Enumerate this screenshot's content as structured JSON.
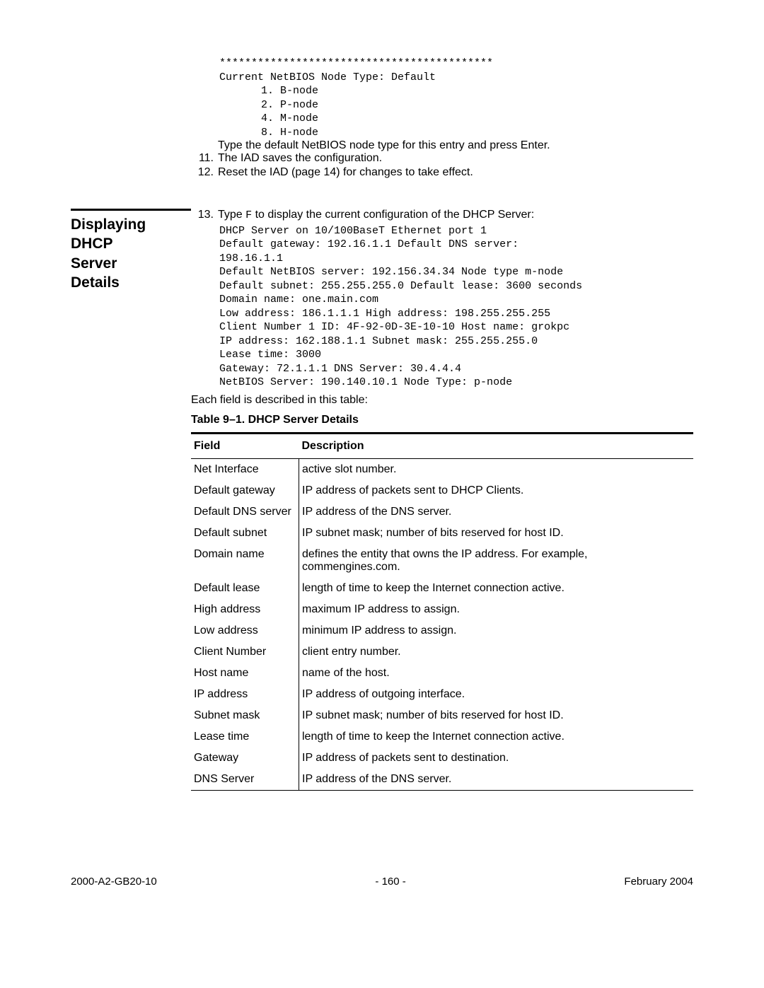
{
  "top_block": {
    "stars": "*******************************************",
    "netbios_line": "Current NetBIOS Node Type: Default",
    "nodes": [
      " 1. B-node",
      " 2. P-node",
      " 4. M-node",
      " 8. H-node"
    ],
    "type_instr": "Type the default NetBIOS node type for this entry and press Enter."
  },
  "steps_11_12": [
    {
      "num": "11.",
      "text": "The IAD saves the configuration."
    },
    {
      "num": "12.",
      "text": "Reset the IAD (page 14) for changes to take effect."
    }
  ],
  "section_heading": {
    "l1": "Displaying",
    "l2": "DHCP",
    "l3": "Server",
    "l4": "Details"
  },
  "step13": {
    "num": "13.",
    "prefix": "Type ",
    "code": "F",
    "suffix": " to display the current configuration of the DHCP Server:"
  },
  "config_lines": [
    "DHCP Server on 10/100BaseT Ethernet port 1",
    "Default gateway: 192.16.1.1 Default DNS server:",
    "198.16.1.1",
    "Default NetBIOS server: 192.156.34.34 Node type m-node",
    "Default subnet: 255.255.255.0 Default lease: 3600 seconds",
    "Domain name: one.main.com",
    "Low address: 186.1.1.1 High address: 198.255.255.255",
    "Client Number 1 ID: 4F-92-0D-3E-10-10 Host name: grokpc",
    "IP address: 162.188.1.1 Subnet mask: 255.255.255.0",
    "Lease time: 3000",
    "Gateway: 72.1.1.1 DNS Server: 30.4.4.4",
    "NetBIOS Server: 190.140.10.1 Node Type: p-node"
  ],
  "table_intro": "Each field is described in this table:",
  "table_caption": "Table 9–1.  DHCP Server Details",
  "table": {
    "headers": {
      "field": "Field",
      "desc": "Description"
    },
    "rows": [
      {
        "field": "Net Interface",
        "desc": "active slot number."
      },
      {
        "field": "Default gateway",
        "desc": "IP address of packets sent to DHCP Clients."
      },
      {
        "field": "Default DNS server",
        "desc": "IP address of the DNS server."
      },
      {
        "field": "Default subnet",
        "desc": "IP subnet mask; number of bits reserved for host ID."
      },
      {
        "field": "Domain name",
        "desc": "defines the entity that owns the IP address. For example, commengines.com."
      },
      {
        "field": "Default lease",
        "desc": "length of time to keep the Internet connection active."
      },
      {
        "field": "High address",
        "desc": "maximum IP address to assign."
      },
      {
        "field": "Low address",
        "desc": "minimum IP address to assign."
      },
      {
        "field": "Client Number",
        "desc": "client entry number."
      },
      {
        "field": "Host name",
        "desc": "name of the host."
      },
      {
        "field": "IP address",
        "desc": "IP address of outgoing interface."
      },
      {
        "field": "Subnet mask",
        "desc": "IP subnet mask; number of bits reserved for host ID."
      },
      {
        "field": "Lease time",
        "desc": "length of time to keep the Internet connection active."
      },
      {
        "field": "Gateway",
        "desc": "IP address of packets sent to destination."
      },
      {
        "field": "DNS Server",
        "desc": "IP address of the DNS server."
      }
    ]
  },
  "footer": {
    "left": "2000-A2-GB20-10",
    "center": "- 160 -",
    "right": "February 2004"
  }
}
